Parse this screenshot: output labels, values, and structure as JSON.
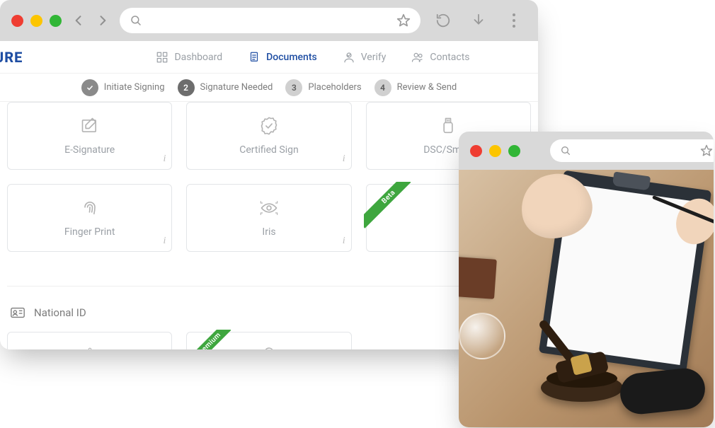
{
  "logo_text": "JRE",
  "nav": {
    "dashboard": "Dashboard",
    "documents": "Documents",
    "verify": "Verify",
    "contacts": "Contacts"
  },
  "steps": {
    "s1": "Initiate Signing",
    "s2_num": "2",
    "s2": "Signature Needed",
    "s3_num": "3",
    "s3": "Placeholders",
    "s4_num": "4",
    "s4": "Review & Send"
  },
  "cards": {
    "esig": "E-Signature",
    "cert": "Certified Sign",
    "dsc": "DSC/Smart",
    "finger": "Finger Print",
    "iris": "Iris",
    "beta_ribbon": "Beta",
    "premium_ribbon": "Premium"
  },
  "section_national_id": "National ID",
  "info_char": "i",
  "search_placeholder": ""
}
